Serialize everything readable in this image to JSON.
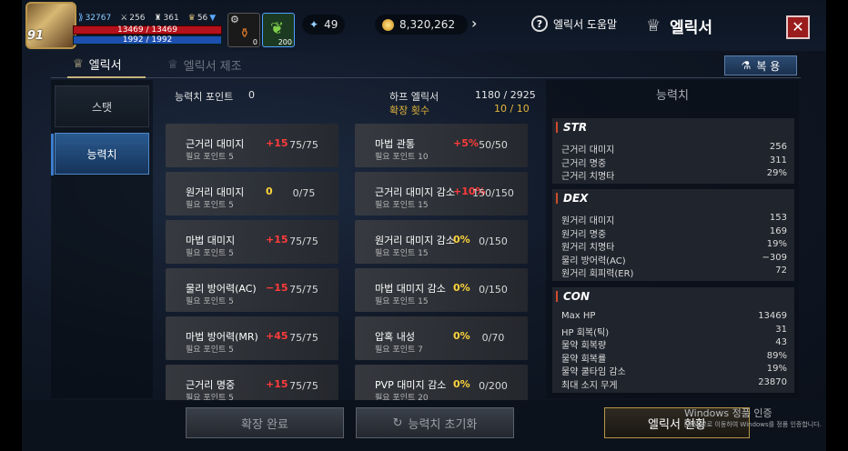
{
  "player": {
    "level": "91",
    "power": "32767",
    "stat1": "256",
    "stat2": "361",
    "stat3": "56",
    "hp": "13469 / 13469",
    "mp": "1992 / 1992"
  },
  "slots": [
    {
      "count": "0"
    },
    {
      "count": "200"
    }
  ],
  "currencies": {
    "gems": "49",
    "gold": "8,320,262"
  },
  "header": {
    "help_label": "엘릭서 도움말",
    "title": "엘릭서",
    "close_icon": "close-icon"
  },
  "tabs": [
    {
      "label": "엘릭서",
      "active": true
    },
    {
      "label": "엘릭서 제조",
      "active": false
    }
  ],
  "bokyong_label": "복 용",
  "nav": [
    {
      "label": "스탯",
      "active": false
    },
    {
      "label": "능력치",
      "active": true
    }
  ],
  "middle": {
    "points_label": "능력치 포인트",
    "points_value": "0",
    "half_label": "하프 엘릭서",
    "half_value": "1180 / 2925",
    "expand_label": "확장 횟수",
    "expand_value": "10 / 10"
  },
  "cards_left": [
    {
      "name": "근거리 대미지",
      "req": "필요 포인트 5",
      "bonus": "+15",
      "level": "75/75",
      "color": "red"
    },
    {
      "name": "원거리 대미지",
      "req": "필요 포인트 5",
      "bonus": "0",
      "level": "0/75",
      "color": "yellow"
    },
    {
      "name": "마법 대미지",
      "req": "필요 포인트 5",
      "bonus": "+15",
      "level": "75/75",
      "color": "red"
    },
    {
      "name": "물리 방어력(AC)",
      "req": "필요 포인트 5",
      "bonus": "−15",
      "level": "75/75",
      "color": "red"
    },
    {
      "name": "마법 방어력(MR)",
      "req": "필요 포인트 5",
      "bonus": "+45",
      "level": "75/75",
      "color": "red"
    },
    {
      "name": "근거리 명중",
      "req": "필요 포인트 5",
      "bonus": "+15",
      "level": "75/75",
      "color": "red"
    }
  ],
  "cards_right": [
    {
      "name": "마법 관통",
      "req": "필요 포인트 10",
      "bonus": "+5%",
      "level": "50/50",
      "color": "red"
    },
    {
      "name": "근거리 대미지 감소",
      "req": "필요 포인트 15",
      "bonus": "+10%",
      "level": "150/150",
      "color": "red"
    },
    {
      "name": "원거리 대미지 감소",
      "req": "필요 포인트 15",
      "bonus": "0%",
      "level": "0/150",
      "color": "yellow"
    },
    {
      "name": "마법 대미지 감소",
      "req": "필요 포인트 15",
      "bonus": "0%",
      "level": "0/150",
      "color": "yellow"
    },
    {
      "name": "압혹 내성",
      "req": "필요 포인트 7",
      "bonus": "0%",
      "level": "0/70",
      "color": "yellow"
    },
    {
      "name": "PVP 대미지 감소",
      "req": "필요 포인트 20",
      "bonus": "0%",
      "level": "0/200",
      "color": "yellow"
    }
  ],
  "stats_panel": {
    "title": "능력치",
    "sections": [
      {
        "header": "STR",
        "rows": [
          {
            "label": "근거리 대미지",
            "value": "256"
          },
          {
            "label": "근거리 명중",
            "value": "311"
          },
          {
            "label": "근거리 치명타",
            "value": "29%"
          }
        ]
      },
      {
        "header": "DEX",
        "rows": [
          {
            "label": "원거리 대미지",
            "value": "153"
          },
          {
            "label": "원거리 명중",
            "value": "169"
          },
          {
            "label": "원거리 치명타",
            "value": "19%"
          },
          {
            "label": "물리 방어력(AC)",
            "value": "−309"
          },
          {
            "label": "원거리 회피력(ER)",
            "value": "72"
          }
        ]
      },
      {
        "header": "CON",
        "rows": [
          {
            "label": "Max HP",
            "value": "13469"
          },
          {
            "label": "HP 회복(틱)",
            "value": "31"
          },
          {
            "label": "물약 회복량",
            "value": "43"
          },
          {
            "label": "물약 회복률",
            "value": "89%"
          },
          {
            "label": "물약 쿨타임 감소",
            "value": "19%"
          },
          {
            "label": "최대 소지 무게",
            "value": "23870"
          }
        ]
      }
    ]
  },
  "bottom": {
    "expand_done": "확장 완료",
    "reset": "능력치 초기화",
    "status": "엘릭서 현황"
  },
  "watermark": {
    "line1": "Windows 정품 인증",
    "line2": "[설정]으로 이동하여 Windows를 정품 인증합니다."
  },
  "colors": {
    "accent_gold": "#c7b27c",
    "bonus_red": "#ff3b3b",
    "bonus_yellow": "#ffd43b",
    "nav_active": "#2a5a90",
    "close_red": "#9a1c1c"
  }
}
